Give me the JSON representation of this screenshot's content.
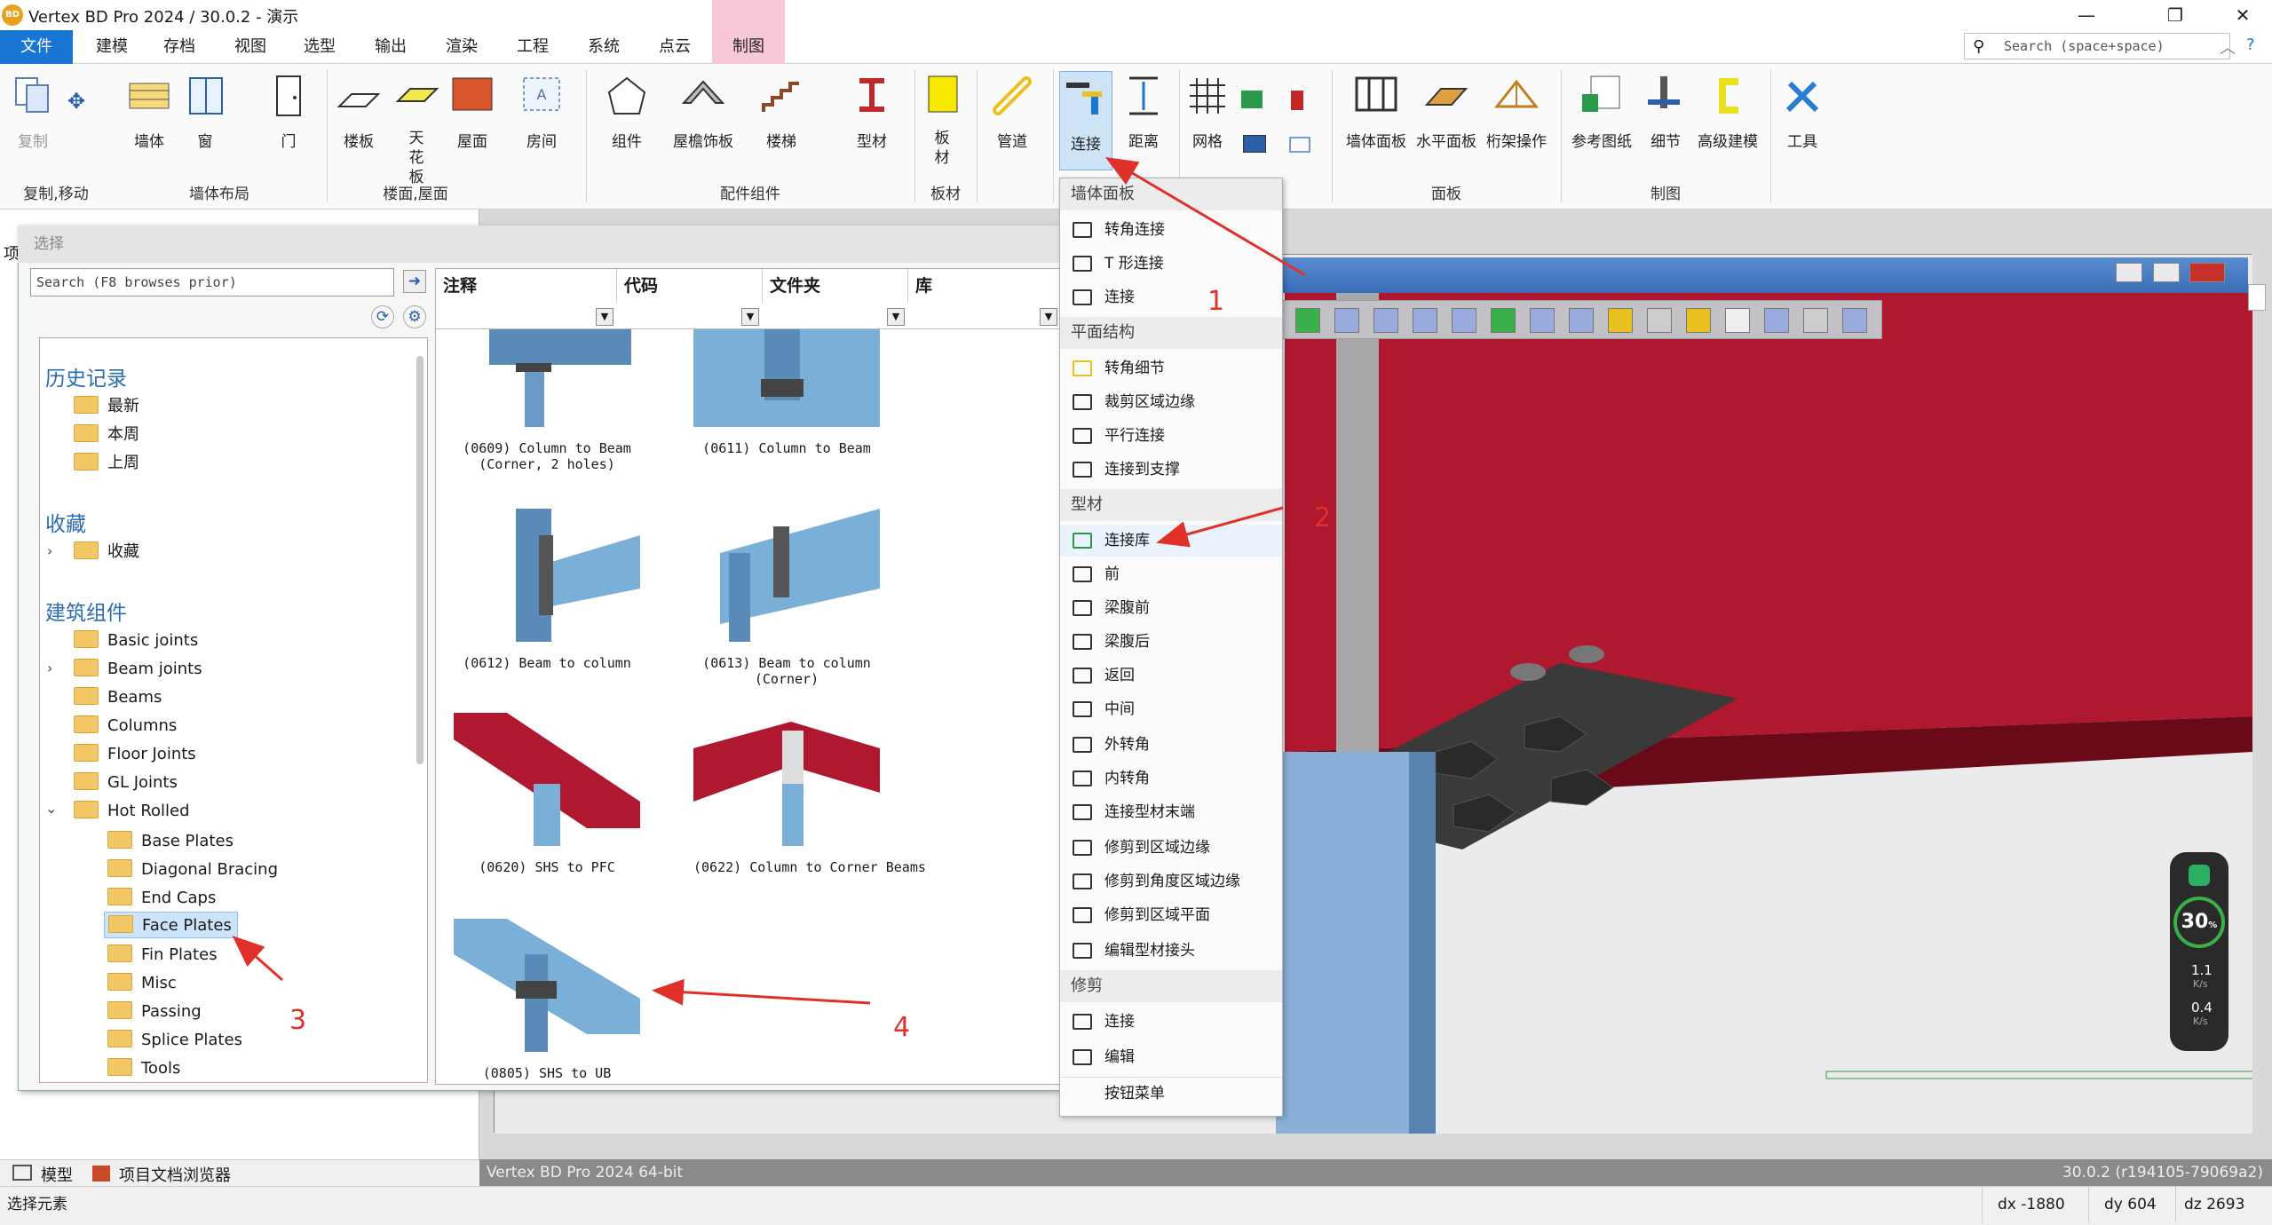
{
  "window": {
    "logo": "BD",
    "title": "Vertex BD Pro 2024 / 30.0.2 - 演示",
    "minimize_icon": "—",
    "restore_icon": "❐",
    "close_icon": "✕"
  },
  "menu": {
    "tabs": [
      "文件",
      "建模",
      "存档",
      "视图",
      "选型",
      "输出",
      "渲染",
      "工程",
      "系统",
      "点云",
      "制图"
    ],
    "search_placeholder": "Search (space+space)"
  },
  "ribbon": {
    "groups": [
      "复制,移动",
      "墙体布局",
      "楼面,屋面",
      "配件组件",
      "板材",
      "面板",
      "制图"
    ],
    "buttons": {
      "copy": "复制",
      "wall": "墙体",
      "window": "窗",
      "door": "门",
      "floor": "楼板",
      "ceiling": "天花板",
      "roof": "屋面",
      "room": "房间",
      "component": "组件",
      "roof_trim": "屋檐饰板",
      "stair": "楼梯",
      "profile": "型材",
      "sheet": "板材",
      "pipe": "管道",
      "connect": "连接",
      "distance": "距离",
      "grid": "网格",
      "wall_panel": "墙体面板",
      "horiz_panel": "水平面板",
      "truss_ops": "桁架操作",
      "ref_drawing": "参考图纸",
      "detail": "细节",
      "adv_model": "高级建模",
      "tools": "工具"
    }
  },
  "dialog": {
    "title": "选择",
    "search_placeholder": "Search (F8 browses prior)",
    "tree": {
      "history_title": "历史记录",
      "history": [
        "最新",
        "本周",
        "上周"
      ],
      "favorites_title": "收藏",
      "favorites": [
        "收藏"
      ],
      "building_title": "建筑组件",
      "building": [
        "Basic joints",
        "Beam joints",
        "Beams",
        "Columns",
        "Floor Joints",
        "GL Joints",
        "Hot Rolled"
      ],
      "hot_rolled": [
        "Base Plates",
        "Diagonal Bracing",
        "End Caps",
        "Face Plates",
        "Fin Plates",
        "Misc",
        "Passing",
        "Splice Plates",
        "Tools"
      ]
    },
    "columns": [
      "注释",
      "代码",
      "文件夹",
      "库"
    ],
    "items": [
      "(0609) Column to Beam\n(Corner, 2 holes)",
      "(0611) Column to Beam",
      "(0612) Beam to column",
      "(0613) Beam to column\n(Corner)",
      "(0620) SHS to PFC",
      "(0622) Column to Corner Beams",
      "(0805) SHS to UB"
    ]
  },
  "dropdown": {
    "sections": [
      {
        "title": "墙体面板",
        "items": [
          "转角连接",
          "T 形连接",
          "连接"
        ]
      },
      {
        "title": "平面结构",
        "items": [
          "转角细节",
          "裁剪区域边缘",
          "平行连接",
          "连接到支撑"
        ]
      },
      {
        "title": "型材",
        "items": [
          "连接库",
          "前",
          "梁腹前",
          "梁腹后",
          "返回",
          "中间",
          "外转角",
          "内转角",
          "连接型材末端",
          "修剪到区域边缘",
          "修剪到角度区域边缘",
          "修剪到区域平面",
          "编辑型材接头"
        ]
      },
      {
        "title": "修剪",
        "items": [
          "连接",
          "编辑",
          "按钮菜单"
        ]
      }
    ]
  },
  "annotations": [
    "1",
    "2",
    "3",
    "4"
  ],
  "bottom": {
    "model_tab": "模型",
    "browser_tab": "项目文档浏览器",
    "viewport_label": "Vertex BD Pro 2024 64-bit",
    "version": "30.0.2 (r194105-79069a2)",
    "status_left": "选择元素",
    "dx": "dx -1880",
    "dy": "dy 604",
    "dz": "dz 2693"
  },
  "net_widget": {
    "percent": "30",
    "percent_unit": "%",
    "up": "1.1",
    "down": "0.4",
    "unit": "K/s"
  },
  "left_stub": {
    "label": "项"
  }
}
